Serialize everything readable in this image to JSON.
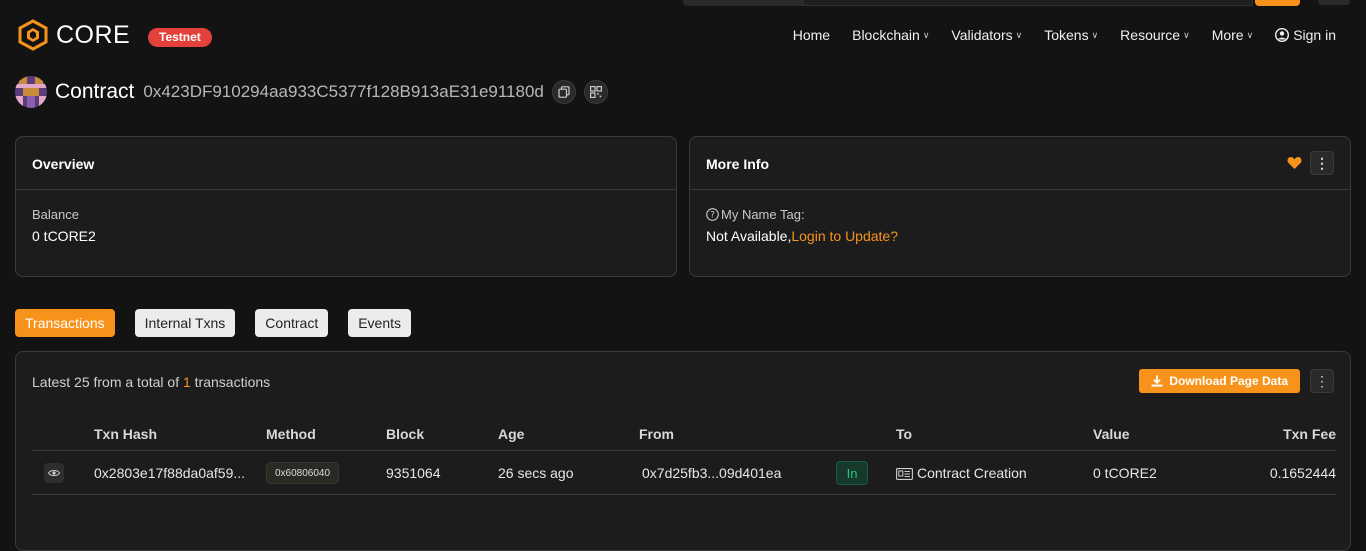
{
  "brand": {
    "name": "CORE",
    "network_badge": "Testnet",
    "accent_color": "#f7931a",
    "badge_color": "#e4413a"
  },
  "nav": {
    "home": "Home",
    "blockchain": "Blockchain",
    "validators": "Validators",
    "tokens": "Tokens",
    "resource": "Resource",
    "more": "More",
    "signin": "Sign in"
  },
  "page": {
    "title": "Contract",
    "address": "0x423DF910294aa933C5377f128B913aE31e91180d"
  },
  "overview": {
    "title": "Overview",
    "balance_label": "Balance",
    "balance_value": "0 tCORE2"
  },
  "more_info": {
    "title": "More Info",
    "name_tag_label": "My Name Tag:",
    "name_tag_value": "Not Available,",
    "name_tag_link": "Login to Update?"
  },
  "tabs": [
    {
      "label": "Transactions",
      "active": true
    },
    {
      "label": "Internal Txns",
      "active": false
    },
    {
      "label": "Contract",
      "active": false
    },
    {
      "label": "Events",
      "active": false
    }
  ],
  "transactions": {
    "summary_prefix": "Latest 25 from a total of",
    "summary_count": "1",
    "summary_suffix": "transactions",
    "download_label": "Download Page Data",
    "columns": [
      "Txn Hash",
      "Method",
      "Block",
      "Age",
      "From",
      "To",
      "Value",
      "Txn Fee"
    ],
    "rows": [
      {
        "hash": "0x2803e17f88da0af59...",
        "method": "0x60806040",
        "block": "9351064",
        "age": "26 secs ago",
        "from": "0x7d25fb3...09d401ea",
        "direction": "In",
        "to": "Contract Creation",
        "value": "0 tCORE2",
        "fee": "0.1652444"
      }
    ]
  }
}
